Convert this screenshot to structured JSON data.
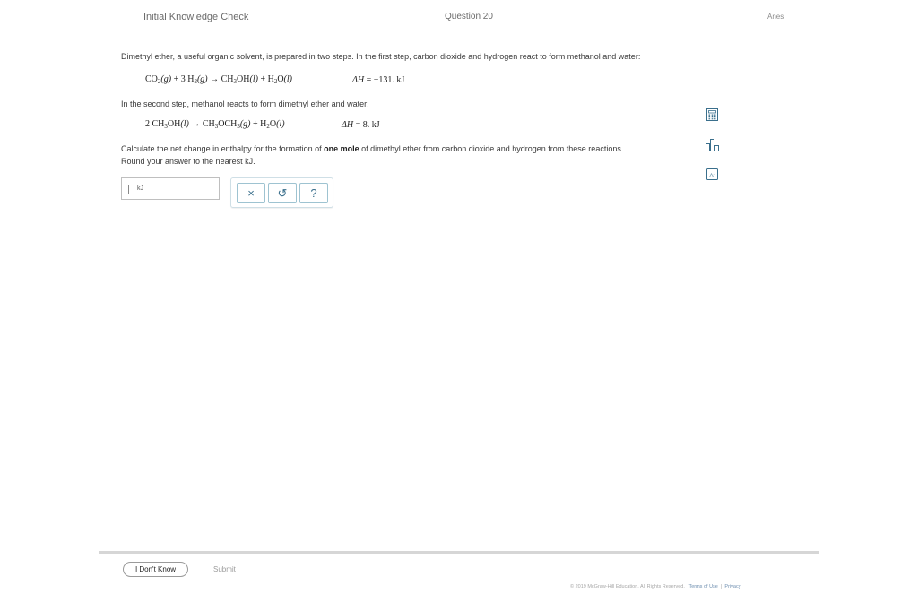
{
  "header": {
    "title": "Initial Knowledge Check",
    "question": "Question 20",
    "user": "Anes"
  },
  "problem": {
    "intro": "Dimethyl ether, a useful organic solvent, is prepared in two steps. In the first step, carbon dioxide and hydrogen react to form methanol and water:",
    "eq1": {
      "co2": "CO",
      "co2_sub": "2",
      "co2_state": "(g)",
      "plus1": " + 3 H",
      "h2_sub": "2",
      "h2_state": "(g)",
      "arrow": " → ",
      "meoh": "CH",
      "meoh_sub": "3",
      "meoh_rest": "OH",
      "meoh_state": "(l)",
      "plus2": " + H",
      "h2o_sub": "2",
      "h2o_rest": "O",
      "h2o_state": "(l)",
      "dh_label": "ΔH",
      "dh_value": " = −131. kJ"
    },
    "second_step": "In the second step, methanol reacts to form dimethyl ether and water:",
    "eq2": {
      "coef": "2 CH",
      "meoh_sub": "3",
      "meoh_rest": "OH",
      "meoh_state": "(l)",
      "arrow": " → ",
      "ether": "CH",
      "ether_sub1": "3",
      "ether_mid": "OCH",
      "ether_sub2": "3",
      "ether_state": "(g)",
      "plus": " + H",
      "h2o_sub": "2",
      "h2o_rest": "O",
      "h2o_state": "(l)",
      "dh_label": "ΔH",
      "dh_value": " = 8. kJ"
    },
    "question_pre": "Calculate the net change in enthalpy for the formation of ",
    "question_bold": "one mole",
    "question_post": " of dimethyl ether from carbon dioxide and hydrogen from these reactions.",
    "round": "Round your answer to the nearest kJ."
  },
  "answer": {
    "value": "",
    "unit": "kJ"
  },
  "buttons": {
    "clear": "×",
    "undo": "↺",
    "help": "?"
  },
  "tools": {
    "calculator": "calculator-icon",
    "chart": "bar-chart-icon",
    "periodic": "periodic-table-icon",
    "periodic_label": "Ar"
  },
  "footer_actions": {
    "dont_know": "I Don't Know",
    "submit": "Submit"
  },
  "footer": {
    "copyright": "© 2019 McGraw-Hill Education. All Rights Reserved.",
    "terms": "Terms of Use",
    "separator": "|",
    "privacy": "Privacy"
  }
}
